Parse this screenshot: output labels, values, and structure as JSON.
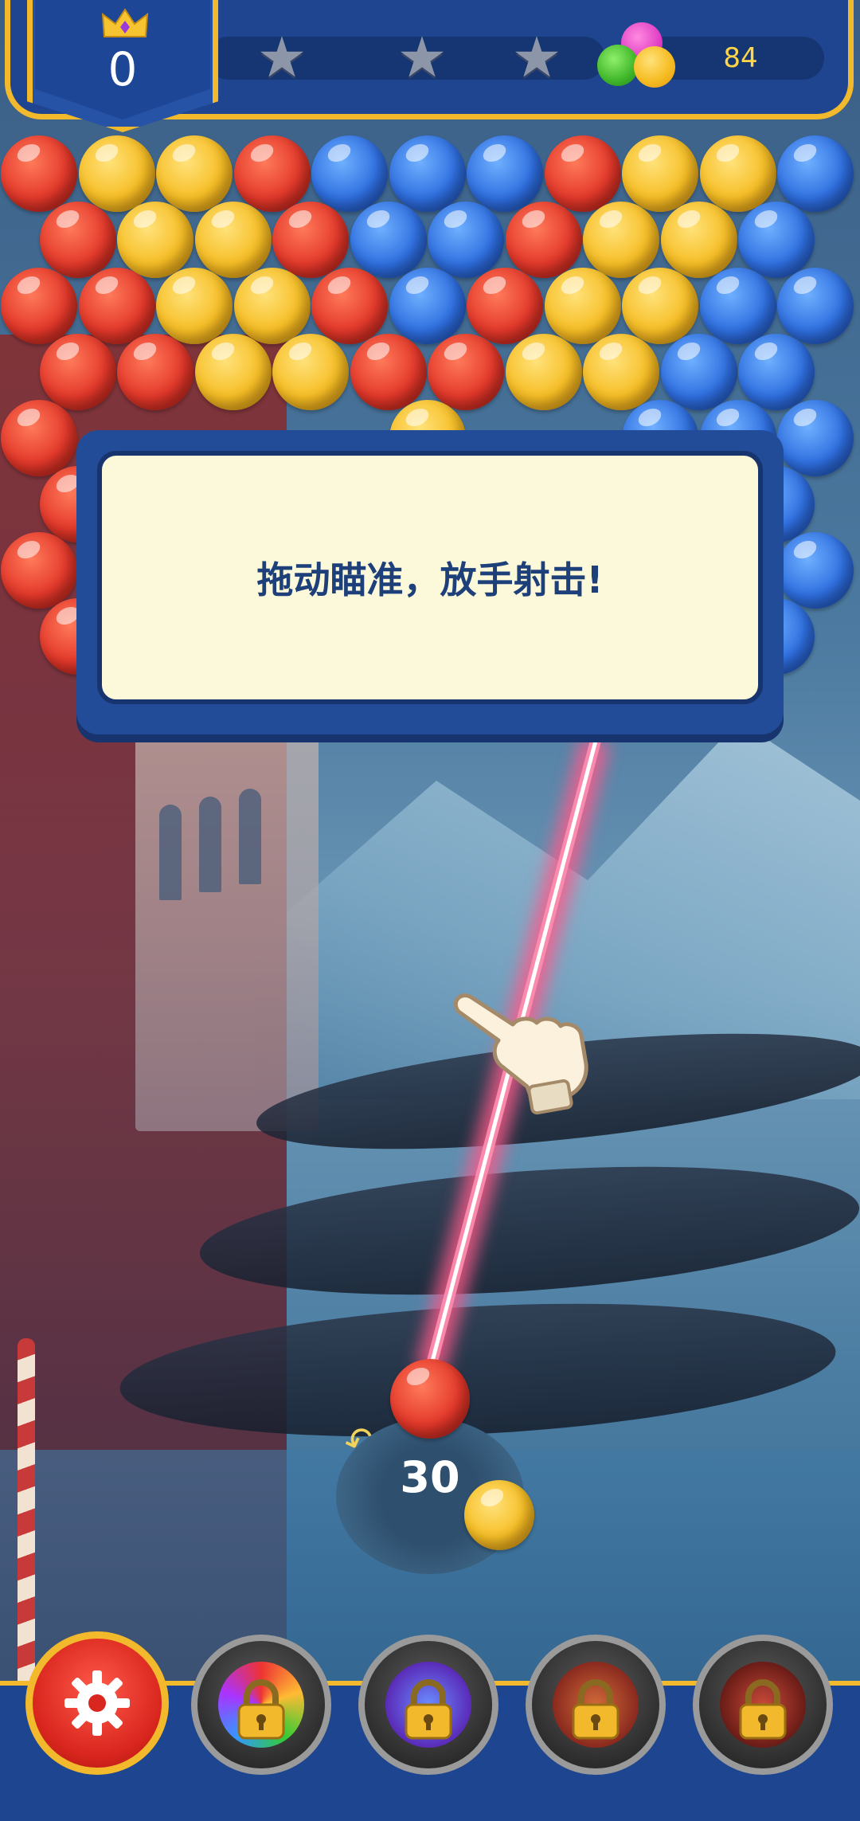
{
  "hud": {
    "score": "0",
    "stars": {
      "earned": 0,
      "total": 3
    },
    "coins": "84",
    "icons": [
      "crown-icon",
      "star-icon",
      "star-icon",
      "star-icon",
      "color-balls-icon"
    ]
  },
  "tutorial": {
    "message": "拖动瞄准，放手射击!"
  },
  "shooter": {
    "shots_left": "30",
    "current_bubble": "red",
    "next_bubble": "yellow"
  },
  "toolbar": {
    "buttons": [
      {
        "name": "settings",
        "icon": "gear-icon",
        "locked": false
      },
      {
        "name": "rainbow-booster",
        "icon": "lock-icon",
        "locked": true
      },
      {
        "name": "color-booster",
        "icon": "lock-icon",
        "locked": true
      },
      {
        "name": "bomb-booster",
        "icon": "lock-icon",
        "locked": true
      },
      {
        "name": "fire-booster",
        "icon": "lock-icon",
        "locked": true
      }
    ]
  },
  "colors": {
    "accent_gold": "#f2b92c",
    "hud_blue": "#1f4590",
    "bubble_red": "#e3382a",
    "bubble_yellow": "#f6bd24",
    "bubble_blue": "#2f6fe0"
  }
}
